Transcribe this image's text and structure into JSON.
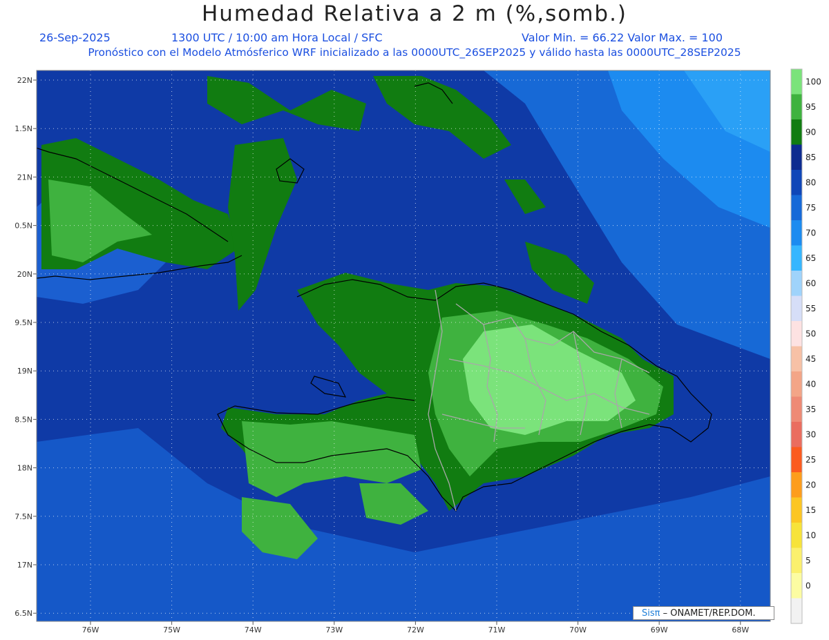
{
  "title": "Humedad Relativa a 2 m (%,somb.)",
  "date": "26-Sep-2025",
  "time_info": "1300 UTC / 10:00 am Hora Local / SFC",
  "minmax": "Valor Min. = 66.22  Valor Max. = 100",
  "model_info": "Pronóstico con el Modelo Atmósferico WRF inicializado a las 0000UTC_26SEP2025 y válido hasta las  0000UTC_28SEP2025",
  "credit": {
    "logo": "Sisπ",
    "text": " – ONAMET/REP.DOM."
  },
  "lat_labels": [
    "22N",
    "1.5N",
    "21N",
    "0.5N",
    "20N",
    "9.5N",
    "19N",
    "8.5N",
    "18N",
    "7.5N",
    "17N",
    "6.5N"
  ],
  "lon_labels": [
    "76W",
    "75W",
    "74W",
    "73W",
    "72W",
    "71W",
    "70W",
    "69W",
    "68W"
  ],
  "legend": {
    "labels": [
      "100",
      "95",
      "90",
      "85",
      "80",
      "75",
      "70",
      "65",
      "60",
      "55",
      "50",
      "45",
      "40",
      "35",
      "30",
      "25",
      "20",
      "15",
      "10",
      "5",
      "0"
    ],
    "colors": [
      "#7be37b",
      "#3fb23f",
      "#117c11",
      "#0d2b8f",
      "#0f46b8",
      "#1669d8",
      "#1c8bf0",
      "#36b6ff",
      "#9fd3fb",
      "#d6def8",
      "#fde2e2",
      "#f7c1a6",
      "#f3a587",
      "#ee8a75",
      "#ea6d5f",
      "#fb5b1f",
      "#fd9d1c",
      "#fcc623",
      "#f7e33a",
      "#fbf06d",
      "#fcfca2",
      "#f2f2f2"
    ]
  },
  "colors": {
    "title_text": "#222222",
    "subtitle_text": "#1b4fe0",
    "sea_deep": "#0f3aa6"
  }
}
